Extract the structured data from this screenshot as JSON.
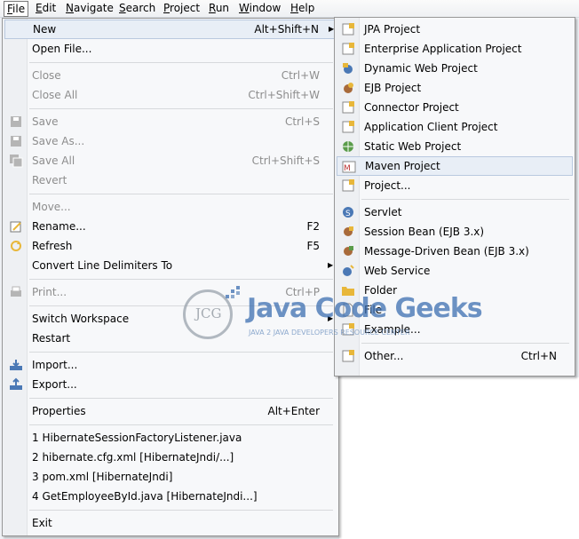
{
  "menubar": [
    {
      "first": "F",
      "rest": "ile",
      "active": true
    },
    {
      "first": "E",
      "rest": "dit"
    },
    {
      "first": "N",
      "rest": "avigate"
    },
    {
      "first": "S",
      "rest": "earch"
    },
    {
      "first": "P",
      "rest": "roject"
    },
    {
      "first": "R",
      "rest": "un"
    },
    {
      "first": "W",
      "rest": "indow"
    },
    {
      "first": "H",
      "rest": "elp"
    }
  ],
  "file_menu": [
    {
      "label": "New",
      "accel": "Alt+Shift+N",
      "submenu": true,
      "highlight": true
    },
    {
      "label": "Open File..."
    },
    {
      "sep": true
    },
    {
      "label": "Close",
      "accel": "Ctrl+W",
      "disabled": true
    },
    {
      "label": "Close All",
      "accel": "Ctrl+Shift+W",
      "disabled": true
    },
    {
      "sep": true
    },
    {
      "label": "Save",
      "accel": "Ctrl+S",
      "disabled": true,
      "icon": "save-icon"
    },
    {
      "label": "Save As...",
      "disabled": true,
      "icon": "save-as-icon"
    },
    {
      "label": "Save All",
      "accel": "Ctrl+Shift+S",
      "disabled": true,
      "icon": "save-all-icon"
    },
    {
      "label": "Revert",
      "disabled": true
    },
    {
      "sep": true
    },
    {
      "label": "Move...",
      "disabled": true
    },
    {
      "label": "Rename...",
      "accel": "F2",
      "icon": "rename-icon"
    },
    {
      "label": "Refresh",
      "accel": "F5",
      "icon": "refresh-icon"
    },
    {
      "label": "Convert Line Delimiters To",
      "submenu": true
    },
    {
      "sep": true
    },
    {
      "label": "Print...",
      "accel": "Ctrl+P",
      "disabled": true,
      "icon": "print-icon"
    },
    {
      "sep": true
    },
    {
      "label": "Switch Workspace",
      "submenu": true
    },
    {
      "label": "Restart"
    },
    {
      "sep": true
    },
    {
      "label": "Import...",
      "icon": "import-icon"
    },
    {
      "label": "Export...",
      "icon": "export-icon"
    },
    {
      "sep": true
    },
    {
      "label": "Properties",
      "accel": "Alt+Enter"
    },
    {
      "sep": true
    },
    {
      "label": "1 HibernateSessionFactoryListener.java"
    },
    {
      "label": "2 hibernate.cfg.xml  [HibernateJndi/...]"
    },
    {
      "label": "3 pom.xml  [HibernateJndi]"
    },
    {
      "label": "4 GetEmployeeById.java  [HibernateJndi...]"
    },
    {
      "sep": true
    },
    {
      "label": "Exit"
    }
  ],
  "new_submenu": [
    {
      "label": "JPA Project",
      "icon": "jpa-project-icon"
    },
    {
      "label": "Enterprise Application Project",
      "icon": "enterprise-app-icon"
    },
    {
      "label": "Dynamic Web Project",
      "icon": "dynamic-web-icon"
    },
    {
      "label": "EJB Project",
      "icon": "ejb-project-icon"
    },
    {
      "label": "Connector Project",
      "icon": "connector-project-icon"
    },
    {
      "label": "Application Client Project",
      "icon": "app-client-icon"
    },
    {
      "label": "Static Web Project",
      "icon": "static-web-icon"
    },
    {
      "label": "Maven Project",
      "icon": "maven-project-icon",
      "highlight": true
    },
    {
      "label": "Project...",
      "icon": "project-icon"
    },
    {
      "sep": true
    },
    {
      "label": "Servlet",
      "icon": "servlet-icon"
    },
    {
      "label": "Session Bean (EJB 3.x)",
      "icon": "session-bean-icon"
    },
    {
      "label": "Message-Driven Bean (EJB 3.x)",
      "icon": "message-bean-icon"
    },
    {
      "label": "Web Service",
      "icon": "web-service-icon"
    },
    {
      "label": "Folder",
      "icon": "folder-icon"
    },
    {
      "label": "File",
      "icon": "file-icon"
    },
    {
      "label": "Example...",
      "icon": "example-icon"
    },
    {
      "sep": true
    },
    {
      "label": "Other...",
      "accel": "Ctrl+N",
      "icon": "other-icon"
    }
  ],
  "watermark": {
    "logo_text": "JCG",
    "brand": "Java Code Geeks",
    "tagline": "JAVA 2 JAVA DEVELOPERS RESOURCE CENTER"
  },
  "colors": {
    "highlight_bg": "#e8eef6",
    "highlight_border": "#b9c9df",
    "disabled_text": "#8d8d8d",
    "brand_blue": "#3d6fb1"
  }
}
